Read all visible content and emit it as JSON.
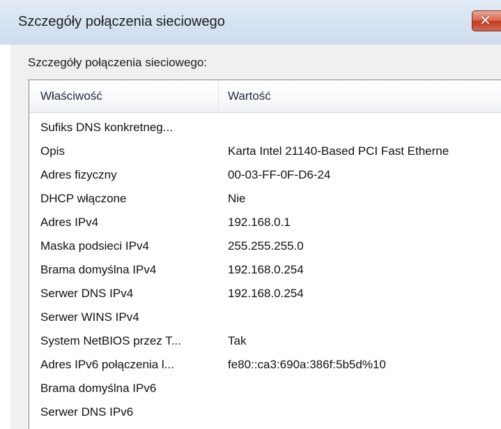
{
  "window": {
    "title": "Szczegóły połączenia sieciowego",
    "close_glyph": "✕",
    "close_icon": "close-icon"
  },
  "group": {
    "label": "Szczegóły połączenia sieciowego:"
  },
  "table": {
    "columns": [
      "Właściwość",
      "Wartość"
    ],
    "rows": [
      {
        "property": "Sufiks DNS konkretneg...",
        "value": ""
      },
      {
        "property": "Opis",
        "value": "Karta Intel 21140-Based PCI Fast Etherne"
      },
      {
        "property": "Adres fizyczny",
        "value": "00-03-FF-0F-D6-24"
      },
      {
        "property": "DHCP włączone",
        "value": "Nie"
      },
      {
        "property": "Adres IPv4",
        "value": "192.168.0.1"
      },
      {
        "property": "Maska podsieci IPv4",
        "value": "255.255.255.0"
      },
      {
        "property": "Brama domyślna IPv4",
        "value": "192.168.0.254"
      },
      {
        "property": "Serwer DNS IPv4",
        "value": "192.168.0.254"
      },
      {
        "property": "Serwer WINS IPv4",
        "value": ""
      },
      {
        "property": "System NetBIOS przez T...",
        "value": "Tak"
      },
      {
        "property": "Adres IPv6 połączenia l...",
        "value": "fe80::ca3:690a:386f:5b5d%10"
      },
      {
        "property": "Brama domyślna IPv6",
        "value": ""
      },
      {
        "property": "Serwer DNS IPv6",
        "value": ""
      }
    ]
  },
  "colors": {
    "titlebar": "#d7e4f2",
    "close_button": "#c2391f",
    "dialog_background": "#f0f0f0"
  }
}
